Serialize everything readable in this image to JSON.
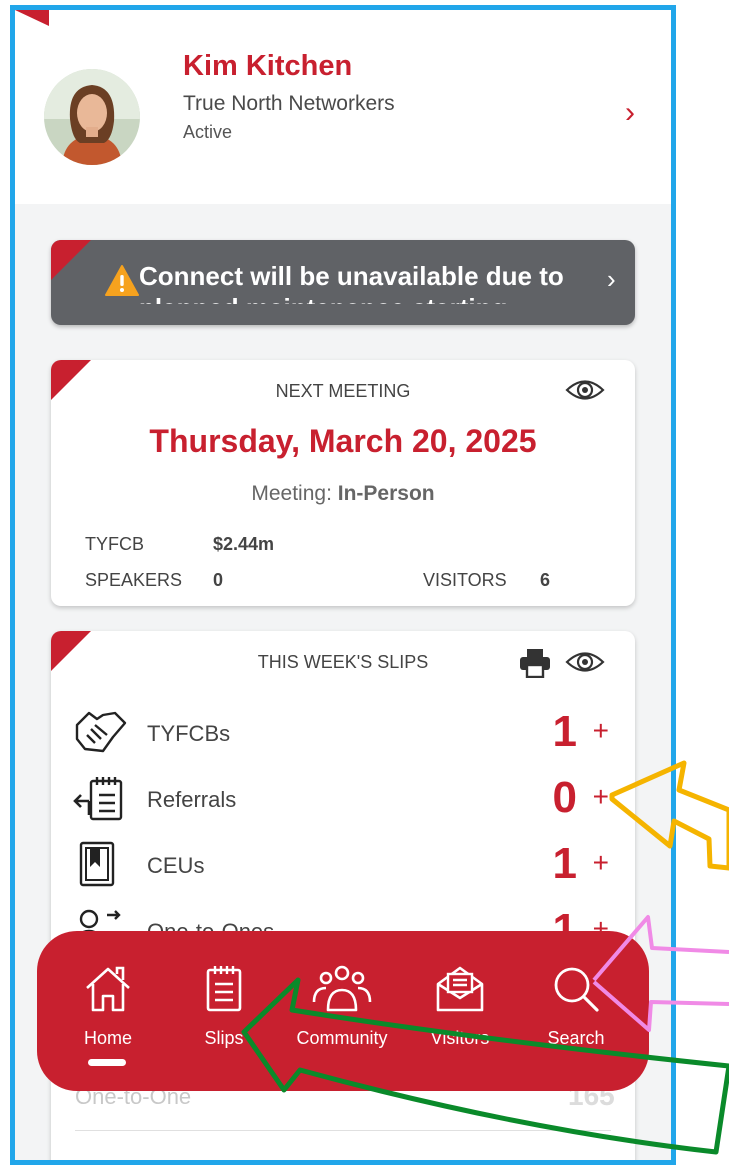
{
  "profile": {
    "name": "Kim Kitchen",
    "chapter": "True North Networkers",
    "status": "Active",
    "chevron": "›"
  },
  "banner": {
    "icon": "warning-icon",
    "text": "Connect will be unavailable due to planned maintenance starting",
    "chevron": "›"
  },
  "next_meeting": {
    "title": "NEXT MEETING",
    "date": "Thursday, March 20, 2025",
    "type_label": "Meeting:",
    "type_value": "In-Person",
    "tyfcb_label": "TYFCB",
    "tyfcb_value": "$2.44m",
    "speakers_label": "SPEAKERS",
    "speakers_value": "0",
    "visitors_label": "VISITORS",
    "visitors_value": "6"
  },
  "slips": {
    "title": "THIS WEEK'S SLIPS",
    "rows": [
      {
        "label": "TYFCBs",
        "count": "1",
        "icon": "handshake-icon"
      },
      {
        "label": "Referrals",
        "count": "0",
        "icon": "referral-list-icon"
      },
      {
        "label": "CEUs",
        "count": "1",
        "icon": "book-icon"
      },
      {
        "label": "One-to-Ones",
        "count": "1",
        "icon": "people-exchange-icon"
      }
    ],
    "plus": "+",
    "behind_label": "One-to-One",
    "behind_count": "165"
  },
  "nav": {
    "items": [
      {
        "label": "Home",
        "icon": "home-icon"
      },
      {
        "label": "Slips",
        "icon": "clipboard-icon"
      },
      {
        "label": "Community",
        "icon": "community-icon"
      },
      {
        "label": "Visitors",
        "icon": "envelope-icon"
      },
      {
        "label": "Search",
        "icon": "search-icon"
      }
    ]
  },
  "colors": {
    "brand_red": "#c8202f",
    "banner_gray": "#606266",
    "frame_blue": "#21a6ea",
    "annotation_yellow": "#f5b400",
    "annotation_pink": "#f08ae6",
    "annotation_green": "#0a8a2a"
  }
}
